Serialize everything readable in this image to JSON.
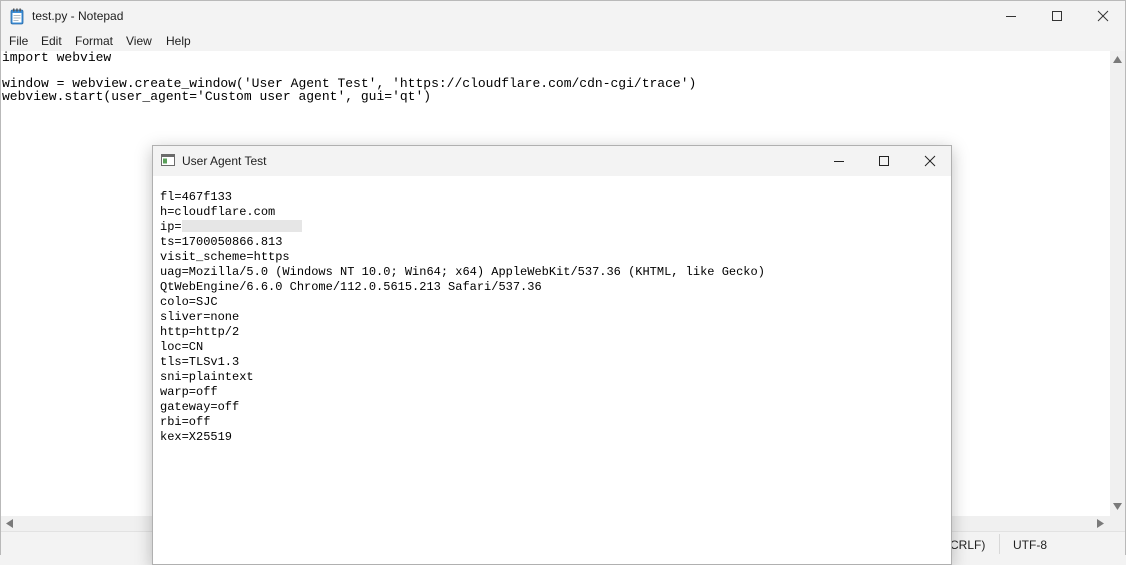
{
  "notepad": {
    "title": "test.py - Notepad",
    "menu": [
      "File",
      "Edit",
      "Format",
      "View",
      "Help"
    ],
    "code_lines": [
      "import webview",
      "",
      "window = webview.create_window('User Agent Test', 'https://cloudflare.com/cdn-cgi/trace')",
      "webview.start(user_agent='Custom user agent', gui='qt')"
    ],
    "status": {
      "line_ending": "CRLF)",
      "encoding": "UTF-8"
    }
  },
  "ua_window": {
    "title": "User Agent Test",
    "trace_lines": [
      "fl=467f133",
      "h=cloudflare.com",
      "ip=",
      "ts=1700050866.813",
      "visit_scheme=https",
      "uag=Mozilla/5.0 (Windows NT 10.0; Win64; x64) AppleWebKit/537.36 (KHTML, like Gecko)",
      "QtWebEngine/6.6.0 Chrome/112.0.5615.213 Safari/537.36",
      "colo=SJC",
      "sliver=none",
      "http=http/2",
      "loc=CN",
      "tls=TLSv1.3",
      "sni=plaintext",
      "warp=off",
      "gateway=off",
      "rbi=off",
      "kex=X25519"
    ]
  },
  "colors": {
    "titlebar": "#f3f3f3",
    "editor_bg": "#ffffff",
    "text": "#000000"
  }
}
